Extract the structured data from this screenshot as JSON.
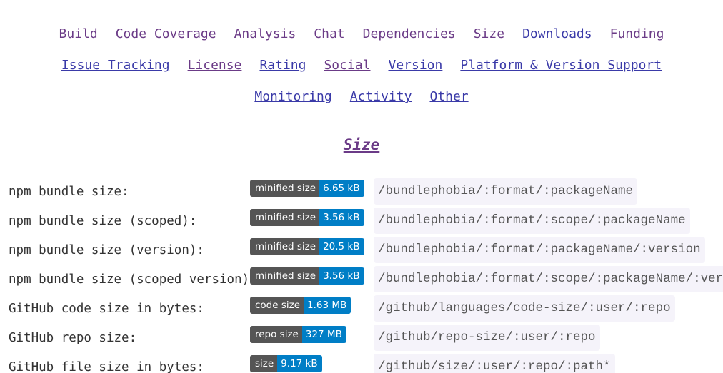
{
  "nav": {
    "row1": [
      {
        "name": "nav-link-build",
        "label": "Build",
        "visited": true
      },
      {
        "name": "nav-link-code-coverage",
        "label": "Code Coverage",
        "visited": true
      },
      {
        "name": "nav-link-analysis",
        "label": "Analysis",
        "visited": true
      },
      {
        "name": "nav-link-chat",
        "label": "Chat",
        "visited": true
      },
      {
        "name": "nav-link-dependencies",
        "label": "Dependencies",
        "visited": true
      },
      {
        "name": "nav-link-size",
        "label": "Size",
        "visited": true
      },
      {
        "name": "nav-link-downloads",
        "label": "Downloads",
        "visited": false
      },
      {
        "name": "nav-link-funding",
        "label": "Funding",
        "visited": true
      }
    ],
    "row2": [
      {
        "name": "nav-link-issue-tracking",
        "label": "Issue Tracking",
        "visited": false
      },
      {
        "name": "nav-link-license",
        "label": "License",
        "visited": true
      },
      {
        "name": "nav-link-rating",
        "label": "Rating",
        "visited": false
      },
      {
        "name": "nav-link-social",
        "label": "Social",
        "visited": true
      },
      {
        "name": "nav-link-version",
        "label": "Version",
        "visited": false
      },
      {
        "name": "nav-link-platform-version-support",
        "label": "Platform & Version Support",
        "visited": false
      }
    ],
    "row3": [
      {
        "name": "nav-link-monitoring",
        "label": "Monitoring",
        "visited": false
      },
      {
        "name": "nav-link-activity",
        "label": "Activity",
        "visited": false
      },
      {
        "name": "nav-link-other",
        "label": "Other",
        "visited": false
      }
    ]
  },
  "section": {
    "title": "Size"
  },
  "colors": {
    "badge_label_bg": "#555555",
    "badge_value_bg": "#007ec6",
    "link": "#3a3aa8",
    "link_visited": "#6b3b87",
    "code_bg": "#f5f3fa"
  },
  "rows": [
    {
      "label": "npm bundle size:",
      "badge_label": "minified size",
      "badge_value": "6.65 kB",
      "path": "/bundlephobia/:format/:packageName"
    },
    {
      "label": "npm bundle size (scoped):",
      "badge_label": "minified size",
      "badge_value": "3.56 kB",
      "path": "/bundlephobia/:format/:scope/:packageName"
    },
    {
      "label": "npm bundle size (version):",
      "badge_label": "minified size",
      "badge_value": "20.5 kB",
      "path": "/bundlephobia/:format/:packageName/:version"
    },
    {
      "label": "npm bundle size (scoped version):",
      "badge_label": "minified size",
      "badge_value": "3.56 kB",
      "path": "/bundlephobia/:format/:scope/:packageName/:version"
    },
    {
      "label": "GitHub code size in bytes:",
      "badge_label": "code size",
      "badge_value": "1.63 MB",
      "path": "/github/languages/code-size/:user/:repo"
    },
    {
      "label": "GitHub repo size:",
      "badge_label": "repo size",
      "badge_value": "327 MB",
      "path": "/github/repo-size/:user/:repo"
    },
    {
      "label": "GitHub file size in bytes:",
      "badge_label": "size",
      "badge_value": "9.17 kB",
      "path": "/github/size/:user/:repo/:path*"
    }
  ]
}
